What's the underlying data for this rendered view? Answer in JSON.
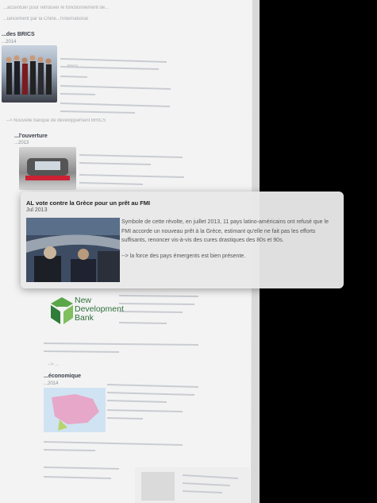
{
  "background_page": {
    "top_line_1": "...accentuer pour retrouver le fonctionnement de...",
    "top_line_2": "...lancement par la Chine...l'international",
    "section_brics": "...des BRICS",
    "section_brics_date": "...2014",
    "brics_text": "...Brics",
    "brics_link": "--> Nouvelle banque de développement BRICS",
    "section_2": "...l'ouverture",
    "section_2_date": "...2013",
    "link_after_ndb": "--> ...",
    "section_3": "...économique",
    "section_3_date": "...2014"
  },
  "card": {
    "title": "AL vote contre la Grèce pour un prêt au FMI",
    "date": "Jul 2013",
    "body": "Symbole de cette révolte, en juillet 2013, 11 pays latino-américains ont refusé que le FMI accorde un nouveau prêt à la Grèce, estimant qu'elle ne fait pas les efforts suffisants, renoncer vis-à-vis des cures drastiques des 80s et 90s.",
    "link": "--> la force des pays émergents est bien présente."
  },
  "ndb_logo": {
    "line1": "New",
    "line2": "Development",
    "line3": "Bank"
  },
  "colors": {
    "page_bg": "#f2f2f2",
    "card_bg": "#e8e8e8",
    "logo_green": "#3c8a3c"
  }
}
